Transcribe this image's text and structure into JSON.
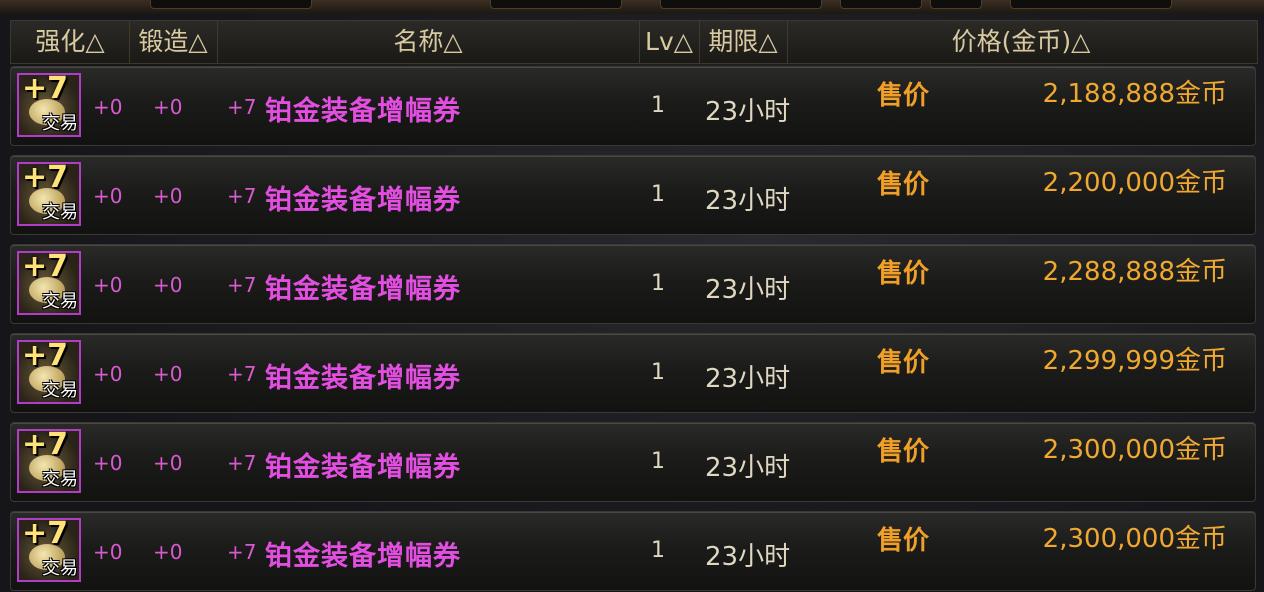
{
  "header": {
    "enhance": "强化△",
    "forge": "锻造△",
    "name": "名称△",
    "lv": "Lv△",
    "period": "期限△",
    "price": "价格(金币)△"
  },
  "colors": {
    "item_name": "#e24ee0",
    "price": "#f0a830",
    "header_text": "#d8c9a0",
    "icon_border": "#b03cc8"
  },
  "rows": [
    {
      "icon": "plus7-ticket-icon",
      "icon_plus": "+7",
      "icon_trade": "交易",
      "enhance": "+0",
      "forge": "+0",
      "prefix": "+7",
      "name": "铂金装备增幅券",
      "lv": "1",
      "period": "23小时",
      "sale_label": "售价",
      "price": "2,188,888金币"
    },
    {
      "icon": "plus7-ticket-icon",
      "icon_plus": "+7",
      "icon_trade": "交易",
      "enhance": "+0",
      "forge": "+0",
      "prefix": "+7",
      "name": "铂金装备增幅券",
      "lv": "1",
      "period": "23小时",
      "sale_label": "售价",
      "price": "2,200,000金币"
    },
    {
      "icon": "plus7-ticket-icon",
      "icon_plus": "+7",
      "icon_trade": "交易",
      "enhance": "+0",
      "forge": "+0",
      "prefix": "+7",
      "name": "铂金装备增幅券",
      "lv": "1",
      "period": "23小时",
      "sale_label": "售价",
      "price": "2,288,888金币"
    },
    {
      "icon": "plus7-ticket-icon",
      "icon_plus": "+7",
      "icon_trade": "交易",
      "enhance": "+0",
      "forge": "+0",
      "prefix": "+7",
      "name": "铂金装备增幅券",
      "lv": "1",
      "period": "23小时",
      "sale_label": "售价",
      "price": "2,299,999金币"
    },
    {
      "icon": "plus7-ticket-icon",
      "icon_plus": "+7",
      "icon_trade": "交易",
      "enhance": "+0",
      "forge": "+0",
      "prefix": "+7",
      "name": "铂金装备增幅券",
      "lv": "1",
      "period": "23小时",
      "sale_label": "售价",
      "price": "2,300,000金币"
    },
    {
      "icon": "plus7-ticket-icon",
      "icon_plus": "+7",
      "icon_trade": "交易",
      "enhance": "+0",
      "forge": "+0",
      "prefix": "+7",
      "name": "铂金装备增幅券",
      "lv": "1",
      "period": "23小时",
      "sale_label": "售价",
      "price": "2,300,000金币"
    }
  ]
}
